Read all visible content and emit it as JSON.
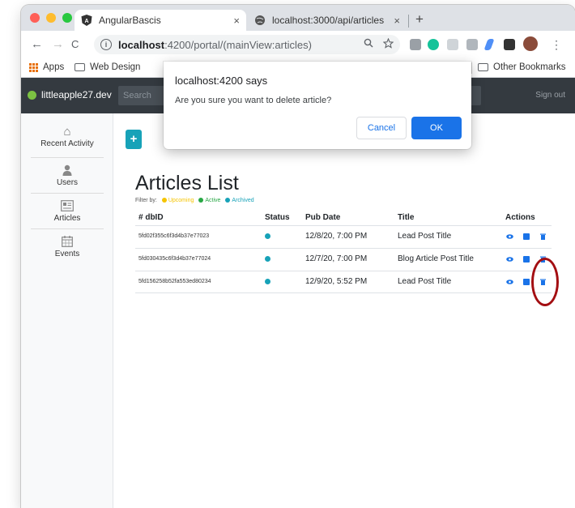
{
  "browser": {
    "tabs": [
      {
        "title": "AngularBascis",
        "close": "×",
        "active": true
      },
      {
        "title": "localhost:3000/api/articles",
        "close": "×",
        "active": false
      }
    ],
    "new_tab": "+",
    "nav": {
      "back": "←",
      "forward": "→",
      "reload": "C"
    },
    "address": {
      "host": "localhost",
      "rest": ":4200/portal/(mainView:articles)"
    },
    "bookmarks": [
      {
        "label": "Apps"
      },
      {
        "label": "Web Design"
      }
    ],
    "bookmarks_more": "»",
    "other_bookmarks": "Other Bookmarks",
    "menu": "⋮"
  },
  "app": {
    "brand": "littleapple27.dev",
    "search_placeholder": "Search",
    "signout": "Sign out",
    "sidebar": [
      {
        "label": "Recent Activity",
        "icon": "home-icon",
        "glyph": "⌂"
      },
      {
        "label": "Users",
        "icon": "user-icon",
        "glyph": "●"
      },
      {
        "label": "Articles",
        "icon": "articles-icon",
        "glyph": "▤"
      },
      {
        "label": "Events",
        "icon": "calendar-icon",
        "glyph": "▦"
      }
    ],
    "add_button": "+",
    "page_title": "Articles List",
    "filter": {
      "label": "Filter by:",
      "options": [
        {
          "label": "Upcoming",
          "color": "#f5c400"
        },
        {
          "label": "Active",
          "color": "#28a745"
        },
        {
          "label": "Archived",
          "color": "#17a2b8"
        }
      ]
    },
    "table": {
      "headers": [
        "# dbID",
        "Status",
        "Pub Date",
        "Title",
        "Actions"
      ],
      "rows": [
        {
          "id": "5fd02f355c6f3d4b37e77023",
          "date": "12/8/20, 7:00 PM",
          "title": "Lead Post Title"
        },
        {
          "id": "5fd030435c6f3d4b37e77024",
          "date": "12/7/20, 7:00 PM",
          "title": "Blog Article Post Title"
        },
        {
          "id": "5fd156258b52fa553ed80234",
          "date": "12/9/20, 5:52 PM",
          "title": "Lead Post Title"
        }
      ]
    }
  },
  "dialog": {
    "title": "localhost:4200 says",
    "message": "Are you sure you want to delete article?",
    "cancel": "Cancel",
    "ok": "OK"
  },
  "colors": {
    "accent": "#17a2b8",
    "primary_blue": "#1a73e8",
    "annotation": "#a30e12",
    "header_dark": "#343a40"
  }
}
